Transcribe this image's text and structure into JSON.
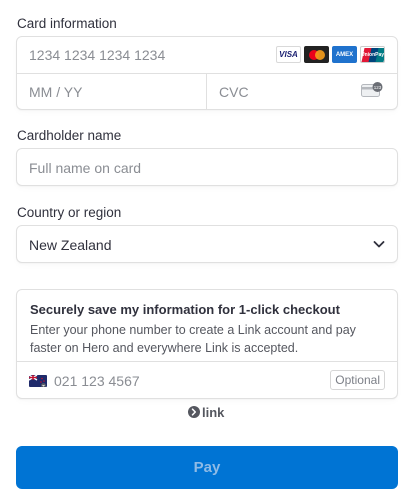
{
  "card": {
    "label": "Card information",
    "number_placeholder": "1234 1234 1234 1234",
    "expiry_placeholder": "MM / YY",
    "cvc_placeholder": "CVC",
    "brands": [
      {
        "name": "visa-icon",
        "text": "VISA"
      },
      {
        "name": "mastercard-icon",
        "text": ""
      },
      {
        "name": "amex-icon",
        "text": "AMEX"
      },
      {
        "name": "unionpay-icon",
        "text": "UnionPay"
      }
    ]
  },
  "cardholder": {
    "label": "Cardholder name",
    "placeholder": "Full name on card"
  },
  "country": {
    "label": "Country or region",
    "value": "New Zealand"
  },
  "link_save": {
    "title": "Securely save my information for 1-click checkout",
    "description": "Enter your phone number to create a Link account and pay faster on Hero and everywhere Link is accepted.",
    "phone_placeholder": "021 123 4567",
    "optional_label": "Optional"
  },
  "link_logo": {
    "text": "link"
  },
  "pay_button": {
    "label": "Pay"
  },
  "colors": {
    "accent": "#0074d4",
    "border": "#e0e0e0",
    "placeholder": "#8a8d93",
    "text": "#30313d"
  }
}
